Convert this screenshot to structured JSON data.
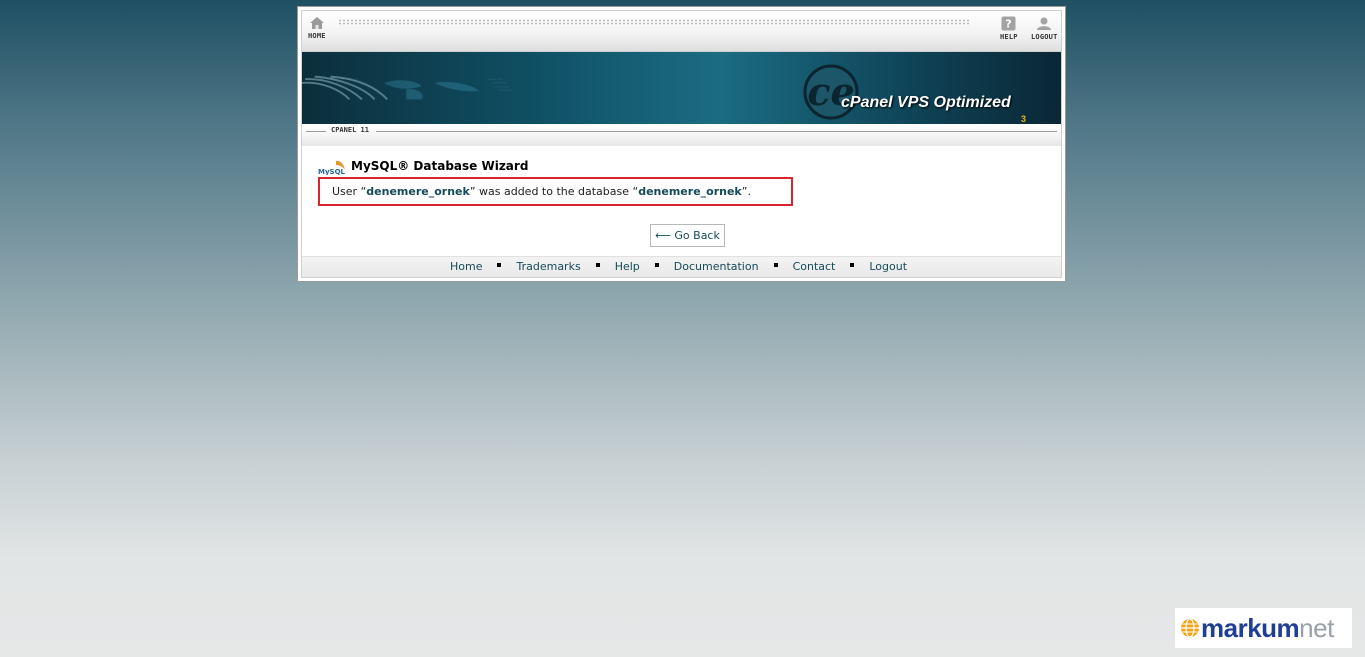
{
  "topbar": {
    "home_label": "HOME",
    "help_label": "HELP",
    "logout_label": "LOGOUT"
  },
  "banner": {
    "brand_text": "cPanel VPS Optimized",
    "brand_sub": "3"
  },
  "crumb": "CPANEL 11",
  "page": {
    "title": "MySQL® Database Wizard",
    "message_prefix": "User “",
    "message_user": "denemere_ornek",
    "message_middle": "” was added to the database “",
    "message_db": "denemere_ornek",
    "message_suffix": "”.",
    "back_label": "⟵ Go Back"
  },
  "footer": {
    "links": [
      "Home",
      "Trademarks",
      "Help",
      "Documentation",
      "Contact",
      "Logout"
    ]
  },
  "watermark": {
    "brand": "markum",
    "suffix": "net"
  },
  "colors": {
    "accent": "#144a5a",
    "highlight_border": "#d9262e"
  }
}
